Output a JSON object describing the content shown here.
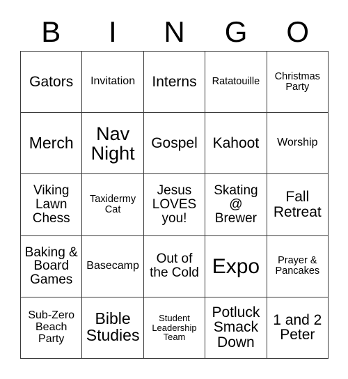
{
  "card": {
    "type": "bingo-card",
    "columns": 5,
    "rows": 5,
    "header_letters": [
      "B",
      "I",
      "N",
      "G",
      "O"
    ],
    "border_color": "#3a3a3a",
    "text_color": "#000000",
    "background_color": "#ffffff",
    "grid": [
      [
        {
          "text": "Gators",
          "size": "fs-xl"
        },
        {
          "text": "Invitation",
          "size": "fs-md"
        },
        {
          "text": "Interns",
          "size": "fs-xl"
        },
        {
          "text": "Ratatouille",
          "size": "fs-sm"
        },
        {
          "text": "Christmas Party",
          "size": "fs-sm"
        }
      ],
      [
        {
          "text": "Merch",
          "size": "fs-2xl"
        },
        {
          "text": "Nav Night",
          "size": "fs-3xl"
        },
        {
          "text": "Gospel",
          "size": "fs-xl"
        },
        {
          "text": "Kahoot",
          "size": "fs-xl"
        },
        {
          "text": "Worship",
          "size": "fs-md"
        }
      ],
      [
        {
          "text": "Viking Lawn Chess",
          "size": "fs-lg"
        },
        {
          "text": "Taxidermy Cat",
          "size": "fs-sm"
        },
        {
          "text": "Jesus LOVES you!",
          "size": "fs-lg"
        },
        {
          "text": "Skating @ Brewer",
          "size": "fs-lg"
        },
        {
          "text": "Fall Retreat",
          "size": "fs-xl"
        }
      ],
      [
        {
          "text": "Baking & Board Games",
          "size": "fs-lg"
        },
        {
          "text": "Basecamp",
          "size": "fs-md"
        },
        {
          "text": "Out of the Cold",
          "size": "fs-lg"
        },
        {
          "text": "Expo",
          "size": "fs-4xl"
        },
        {
          "text": "Prayer & Pancakes",
          "size": "fs-sm"
        }
      ],
      [
        {
          "text": "Sub-Zero Beach Party",
          "size": "fs-md"
        },
        {
          "text": "Bible Studies",
          "size": "fs-2xl"
        },
        {
          "text": "Student Leadership Team",
          "size": "fs-xs"
        },
        {
          "text": "Potluck Smack Down",
          "size": "fs-xl"
        },
        {
          "text": "1 and 2 Peter",
          "size": "fs-xl"
        }
      ]
    ]
  }
}
